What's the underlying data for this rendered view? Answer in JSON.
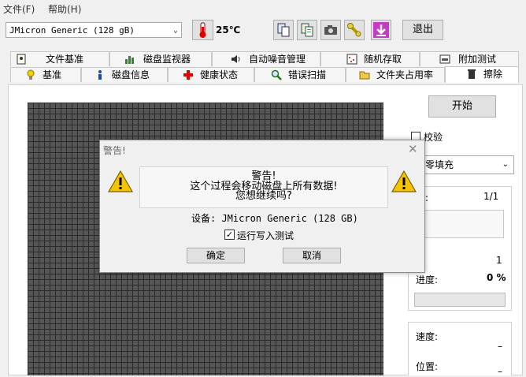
{
  "menu": {
    "file": "文件(F)",
    "help": "帮助(H)"
  },
  "toolbar": {
    "drive": "JMicron Generic (128 gB)",
    "temperature": "25℃",
    "exit": "退出"
  },
  "tabs_row1": [
    "文件基准",
    "磁盘监视器",
    "自动噪音管理",
    "随机存取",
    "附加测试"
  ],
  "tabs_row2": [
    "基准",
    "磁盘信息",
    "健康状态",
    "错误扫描",
    "文件夹占用率",
    "擦除"
  ],
  "erase": {
    "start_button": "开始",
    "verify_label": "校验",
    "fill_mode": "零填充",
    "pass_label": "过:",
    "pass_value": "1/1",
    "count_value": "1",
    "progress_label": "进度:",
    "progress_value": "0 %",
    "progress_fraction": 0,
    "speed_label": "速度:",
    "speed_value": "–",
    "position_label": "位置:",
    "position_value": "–"
  },
  "dialog": {
    "title": "警告!",
    "line1": "警告!",
    "line2": "这个过程会移动磁盘上所有数据!",
    "line3": "您想继续吗?",
    "device_line": "设备: JMicron Generic (128 GB)",
    "write_test_label": "运行写入测试",
    "write_test_checked": true,
    "ok_button": "确定",
    "cancel_button": "取消"
  },
  "icons": {
    "thermometer": "thermometer-icon",
    "copy": "copy-icon",
    "copy2": "copy-info-icon",
    "camera": "camera-icon",
    "tool": "wrench-icon",
    "download": "download-icon",
    "warning": "warning-icon"
  },
  "colors": {
    "grid_fill": "#565656",
    "grid_line": "#2a2a2a",
    "warning_yellow": "#f5c400"
  }
}
